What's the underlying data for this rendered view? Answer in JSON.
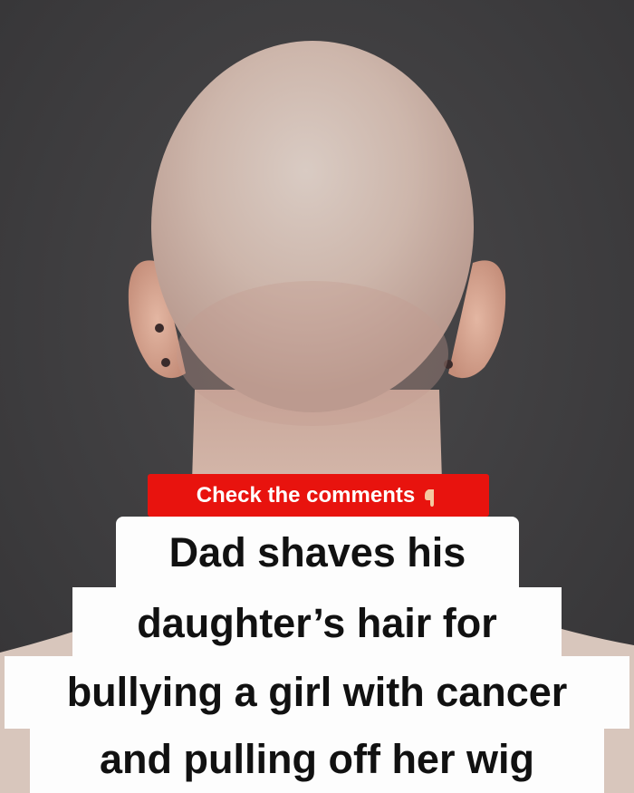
{
  "cta": {
    "text": "Check the comments",
    "icon": "pointing-down-hand-icon",
    "color": "#e8130e"
  },
  "headline": {
    "lines": [
      "Dad shaves his",
      "daughter’s hair for",
      "bullying a girl with cancer",
      "and pulling off her wig"
    ]
  },
  "colors": {
    "background": "#3f3e40",
    "caption_bg": "#fdfdfd",
    "caption_text": "#111111"
  }
}
